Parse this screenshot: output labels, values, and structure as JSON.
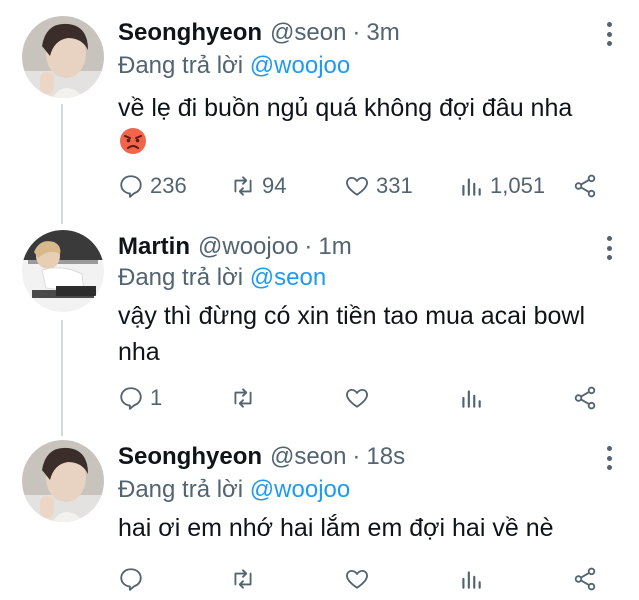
{
  "tweets": [
    {
      "name": "Seonghyeon",
      "handle": "@seon",
      "separator": "·",
      "time": "3m",
      "reply_prefix": "Đang trả lời",
      "reply_handle": "@woojoo",
      "text": "về lẹ đi buồn ngủ quá không đợi đâu nha",
      "emoji": "angry-face",
      "replies": "236",
      "retweets": "94",
      "likes": "331",
      "views": "1,051"
    },
    {
      "name": "Martin",
      "handle": "@woojoo",
      "separator": "·",
      "time": "1m",
      "reply_prefix": "Đang trả lời",
      "reply_handle": "@seon",
      "text": "vậy thì đừng có xin tiền tao mua acai bowl nha",
      "replies": "1",
      "retweets": "",
      "likes": "",
      "views": ""
    },
    {
      "name": "Seonghyeon",
      "handle": "@seon",
      "separator": "·",
      "time": "18s",
      "reply_prefix": "Đang trả lời",
      "reply_handle": "@woojoo",
      "text": "hai ơi em nhớ hai lắm em đợi hai về nè",
      "replies": "",
      "retweets": "",
      "likes": "",
      "views": ""
    }
  ],
  "colors": {
    "text": "#0f1419",
    "muted": "#536471",
    "link": "#1d9bf0",
    "thread_line": "#cfd9de"
  },
  "icons": [
    "reply-icon",
    "retweet-icon",
    "like-icon",
    "views-icon",
    "share-icon",
    "more-icon"
  ]
}
